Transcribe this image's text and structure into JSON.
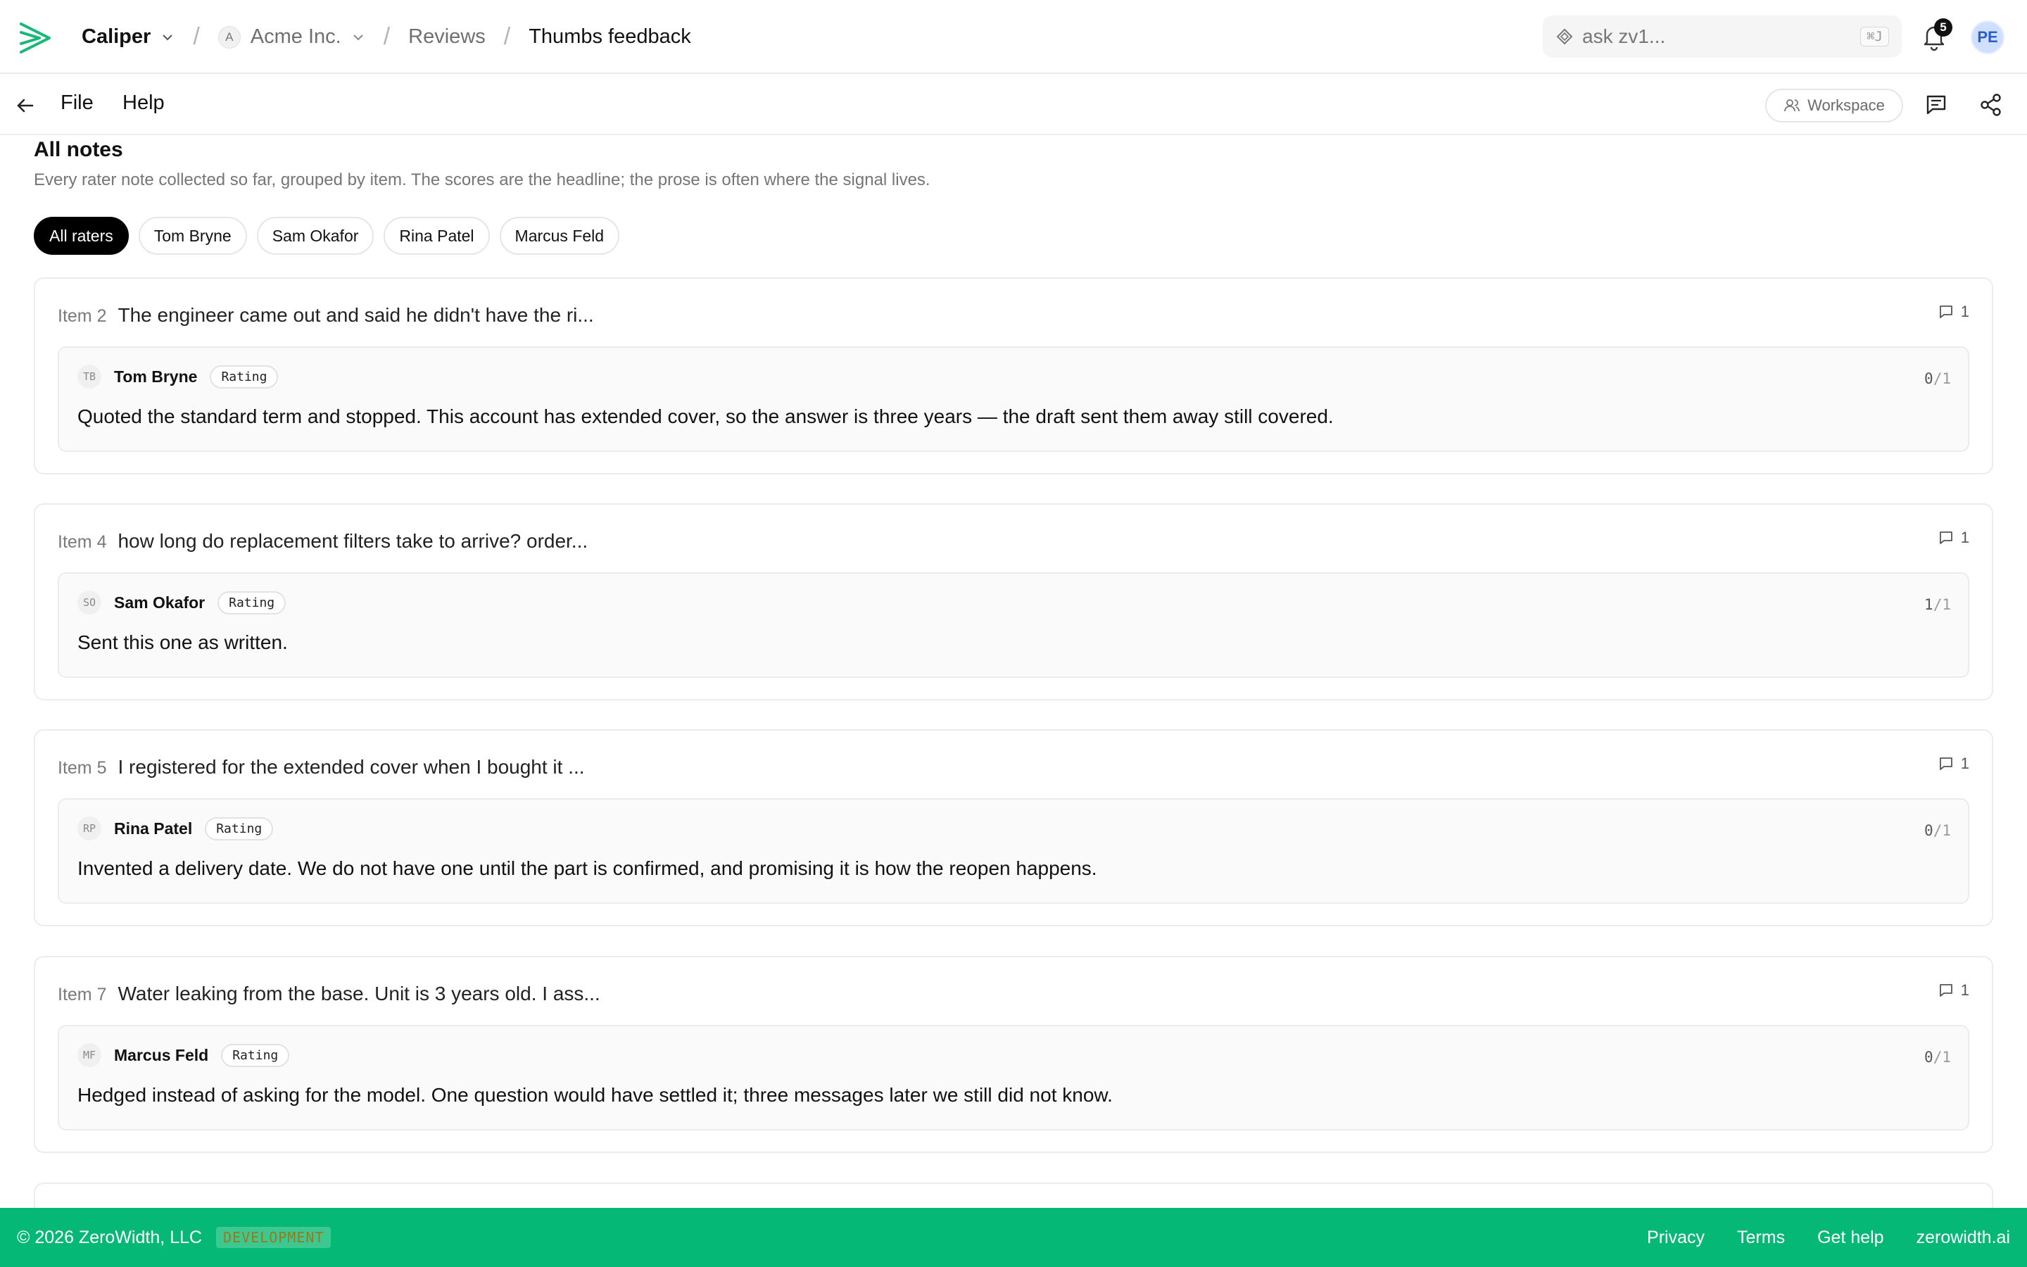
{
  "header": {
    "app_name": "Caliper",
    "org_initial": "A",
    "org_name": "Acme Inc.",
    "crumb_reviews": "Reviews",
    "crumb_current": "Thumbs feedback",
    "search_placeholder": "ask zv1...",
    "search_shortcut": "⌘J",
    "notification_count": "5",
    "user_initials": "PE"
  },
  "toolbar": {
    "file_label": "File",
    "help_label": "Help",
    "workspace_label": "Workspace"
  },
  "section": {
    "title": "All notes",
    "subtitle": "Every rater note collected so far, grouped by item. The scores are the headline; the prose is often where the signal lives."
  },
  "filters": [
    "All raters",
    "Tom Bryne",
    "Sam Okafor",
    "Rina Patel",
    "Marcus Feld"
  ],
  "items": [
    {
      "label": "Item 2",
      "text": "The engineer came out and said he didn't have the ri...",
      "count": "1",
      "note": {
        "initials": "TB",
        "rater": "Tom Bryne",
        "tag": "Rating",
        "score": "0",
        "score_den": "/1",
        "text": "Quoted the standard term and stopped. This account has extended cover, so the answer is three years — the draft sent them away still covered."
      }
    },
    {
      "label": "Item 4",
      "text": "how long do replacement filters take to arrive? order...",
      "count": "1",
      "note": {
        "initials": "SO",
        "rater": "Sam Okafor",
        "tag": "Rating",
        "score": "1",
        "score_den": "/1",
        "text": "Sent this one as written."
      }
    },
    {
      "label": "Item 5",
      "text": "I registered for the extended cover when I bought it ...",
      "count": "1",
      "note": {
        "initials": "RP",
        "rater": "Rina Patel",
        "tag": "Rating",
        "score": "0",
        "score_den": "/1",
        "text": "Invented a delivery date. We do not have one until the part is confirmed, and promising it is how the reopen happens."
      }
    },
    {
      "label": "Item 7",
      "text": "Water leaking from the base. Unit is 3 years old. I ass...",
      "count": "1",
      "note": {
        "initials": "MF",
        "rater": "Marcus Feld",
        "tag": "Rating",
        "score": "0",
        "score_den": "/1",
        "text": "Hedged instead of asking for the model. One question would have settled it; three messages later we still did not know."
      }
    }
  ],
  "footer": {
    "copyright": "© 2026 ZeroWidth, LLC",
    "env_badge": "DEVELOPMENT",
    "links": [
      "Privacy",
      "Terms",
      "Get help",
      "zerowidth.ai"
    ]
  },
  "colors": {
    "brand_green": "#06b876",
    "logo_green": "#16b97a"
  }
}
